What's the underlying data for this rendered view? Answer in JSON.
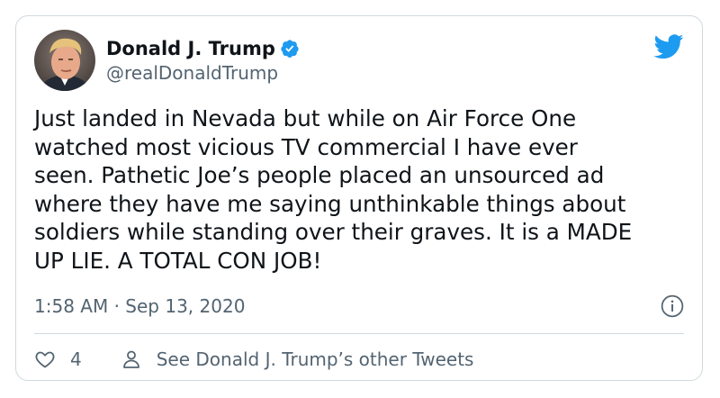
{
  "author": {
    "name": "Donald J. Trump",
    "handle": "@realDonaldTrump",
    "verified": true
  },
  "tweet": {
    "text": "Just landed in Nevada but while on Air Force One\nwatched most vicious TV commercial I have ever\nseen. Pathetic Joe’s people placed an unsourced ad\nwhere they have me saying unthinkable things about\nsoldiers while standing over their graves. It is a MADE\nUP LIE. A TOTAL CON JOB!",
    "time": "1:58 AM",
    "separator": "·",
    "date": "Sep 13, 2020"
  },
  "actions": {
    "like_count": "4",
    "other_tweets_label": "See Donald J. Trump’s other Tweets"
  },
  "colors": {
    "brand_blue": "#1d9bf0",
    "text_primary": "#0f1419",
    "text_secondary": "#536471",
    "border": "#cfd9de"
  },
  "icons": [
    "avatar-photo",
    "verified-badge-icon",
    "twitter-bird-icon",
    "info-icon",
    "heart-icon",
    "person-icon"
  ]
}
